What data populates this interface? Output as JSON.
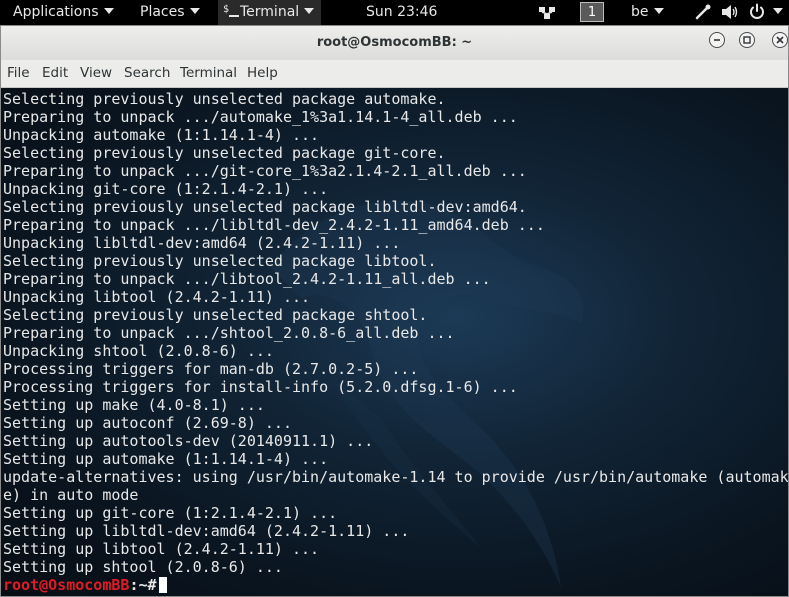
{
  "topbar": {
    "applications_label": "Applications",
    "places_label": "Places",
    "terminal_label": "Terminal",
    "clock": "Sun 23:46",
    "workspace_number": "1",
    "keyboard_layout": "be"
  },
  "window": {
    "title": "root@OsmocomBB: ~"
  },
  "menubar": {
    "items": [
      "File",
      "Edit",
      "View",
      "Search",
      "Terminal",
      "Help"
    ]
  },
  "terminal": {
    "lines": [
      "Selecting previously unselected package automake.",
      "Preparing to unpack .../automake_1%3a1.14.1-4_all.deb ...",
      "Unpacking automake (1:1.14.1-4) ...",
      "Selecting previously unselected package git-core.",
      "Preparing to unpack .../git-core_1%3a2.1.4-2.1_all.deb ...",
      "Unpacking git-core (1:2.1.4-2.1) ...",
      "Selecting previously unselected package libltdl-dev:amd64.",
      "Preparing to unpack .../libltdl-dev_2.4.2-1.11_amd64.deb ...",
      "Unpacking libltdl-dev:amd64 (2.4.2-1.11) ...",
      "Selecting previously unselected package libtool.",
      "Preparing to unpack .../libtool_2.4.2-1.11_all.deb ...",
      "Unpacking libtool (2.4.2-1.11) ...",
      "Selecting previously unselected package shtool.",
      "Preparing to unpack .../shtool_2.0.8-6_all.deb ...",
      "Unpacking shtool (2.0.8-6) ...",
      "Processing triggers for man-db (2.7.0.2-5) ...",
      "Processing triggers for install-info (5.2.0.dfsg.1-6) ...",
      "Setting up make (4.0-8.1) ...",
      "Setting up autoconf (2.69-8) ...",
      "Setting up autotools-dev (20140911.1) ...",
      "Setting up automake (1:1.14.1-4) ...",
      "update-alternatives: using /usr/bin/automake-1.14 to provide /usr/bin/automake (automak",
      "e) in auto mode",
      "Setting up git-core (1:2.1.4-2.1) ...",
      "Setting up libltdl-dev:amd64 (2.4.2-1.11) ...",
      "Setting up libtool (2.4.2-1.11) ...",
      "Setting up shtool (2.0.8-6) ..."
    ],
    "prompt_user_host": "root@OsmocomBB",
    "prompt_path": ":~#"
  },
  "colors": {
    "prompt_user": "#e01b24",
    "terminal_text": "#e8e8e8",
    "topbar_bg": "#000000"
  },
  "icons": {
    "terminal_app": "terminal-prompt-icon",
    "network": "network-icon",
    "input_device": "mouse-icon",
    "volume": "volume-icon",
    "power": "power-icon",
    "minimize": "minimize-icon",
    "maximize": "maximize-icon",
    "close": "close-icon"
  }
}
